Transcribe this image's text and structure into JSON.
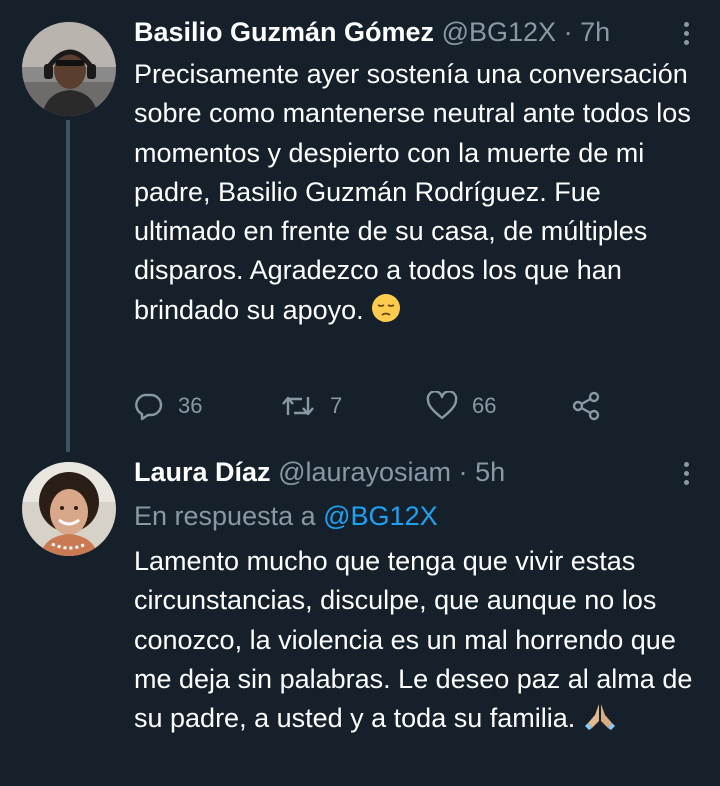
{
  "tweets": [
    {
      "author_name": "Basilio Guzmán Gómez",
      "handle": "@BG12X",
      "separator": "·",
      "time": "7h",
      "text": "Precisamente ayer sostenía una conversación sobre como mantenerse neutral ante todos los momentos y despierto con la muerte de mi padre, Basilio Guzmán Rodríguez. Fue ultimado en frente de su casa, de múltiples disparos. Agradezco a todos los que han brindado su apoyo.",
      "emoji": "pensive-face",
      "reply_count": "36",
      "retweet_count": "7",
      "like_count": "66"
    },
    {
      "author_name": "Laura Díaz",
      "handle": "@laurayosiam",
      "separator": "·",
      "time": "5h",
      "reply_prefix": "En respuesta a",
      "reply_mention": "@BG12X",
      "text": "Lamento mucho que tenga que vivir estas circunstancias, disculpe, que aunque no los conozco, la violencia es un mal horrendo que me deja sin palabras. Le deseo paz al alma de su padre, a usted y a toda su familia.",
      "emoji": "folded-hands"
    }
  ],
  "colors": {
    "background": "#15202b",
    "secondary_text": "#8899a6",
    "link": "#1da1f2",
    "thread_line": "#3d5466"
  }
}
